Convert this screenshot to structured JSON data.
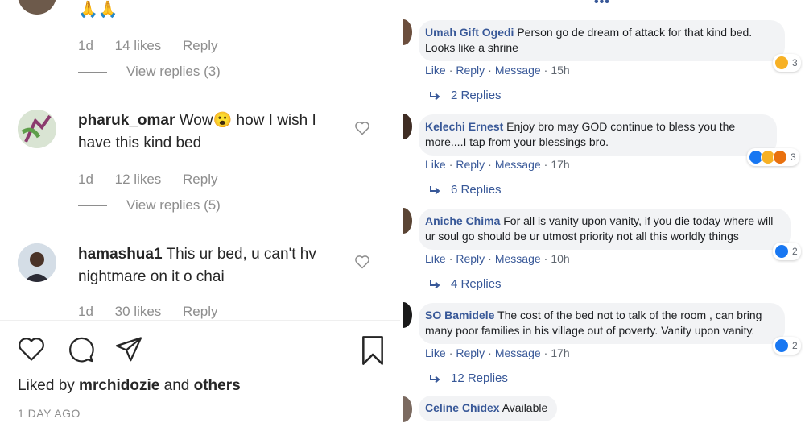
{
  "instagram": {
    "top_comment": {
      "emoji": "🙏🙏",
      "age": "1d",
      "likes": "14 likes",
      "reply": "Reply",
      "view_replies": "View replies (3)"
    },
    "comments": [
      {
        "user": "pharuk_omar",
        "text_before": "Wow",
        "emoji": "😮",
        "text_after": " how I wish I have this kind bed",
        "age": "1d",
        "likes": "12 likes",
        "reply": "Reply",
        "view_replies": "View replies (5)"
      },
      {
        "user": "hamashua1",
        "text": "This ur bed, u can't hv nightmare on it o chai",
        "age": "1d",
        "likes": "30 likes",
        "reply": "Reply"
      }
    ],
    "liked_prefix": "Liked by ",
    "liked_user": "mrchidozie",
    "liked_mid": " and ",
    "liked_others": "others",
    "day_ago": "1 DAY AGO"
  },
  "facebook": {
    "more_dots": "•••",
    "comments": [
      {
        "name": "Umah Gift Ogedi",
        "text": "Person go de dream of attack for that kind bed. Looks like a shrine",
        "like": "Like",
        "reply": "Reply",
        "message": "Message",
        "time": "15h",
        "reactions": [
          "haha"
        ],
        "reaction_count": "3",
        "replies": "2 Replies"
      },
      {
        "name": "Kelechi Ernest",
        "text": "Enjoy bro may GOD continue to bless you the more....I tap from your blessings bro.",
        "like": "Like",
        "reply": "Reply",
        "message": "Message",
        "time": "17h",
        "reactions": [
          "like",
          "haha",
          "angry"
        ],
        "reaction_count": "3",
        "replies": "6 Replies"
      },
      {
        "name": "Aniche Chima",
        "text": "For all is vanity upon vanity, if you die today where will ur soul go should be ur utmost priority not all this worldly things",
        "like": "Like",
        "reply": "Reply",
        "message": "Message",
        "time": "10h",
        "reactions": [
          "like"
        ],
        "reaction_count": "2",
        "replies": "4 Replies"
      },
      {
        "name": "SO Bamidele",
        "text": "The cost of the bed not to talk of the room , can bring many poor families in his village out of poverty. Vanity upon vanity.",
        "like": "Like",
        "reply": "Reply",
        "message": "Message",
        "time": "17h",
        "reactions": [
          "like"
        ],
        "reaction_count": "2",
        "replies": "12 Replies"
      },
      {
        "name": "Celine Chidex",
        "text": "Available"
      }
    ],
    "colors": {
      "link": "#385898",
      "bubble": "#f2f3f5",
      "meta_gray": "#606770"
    }
  }
}
